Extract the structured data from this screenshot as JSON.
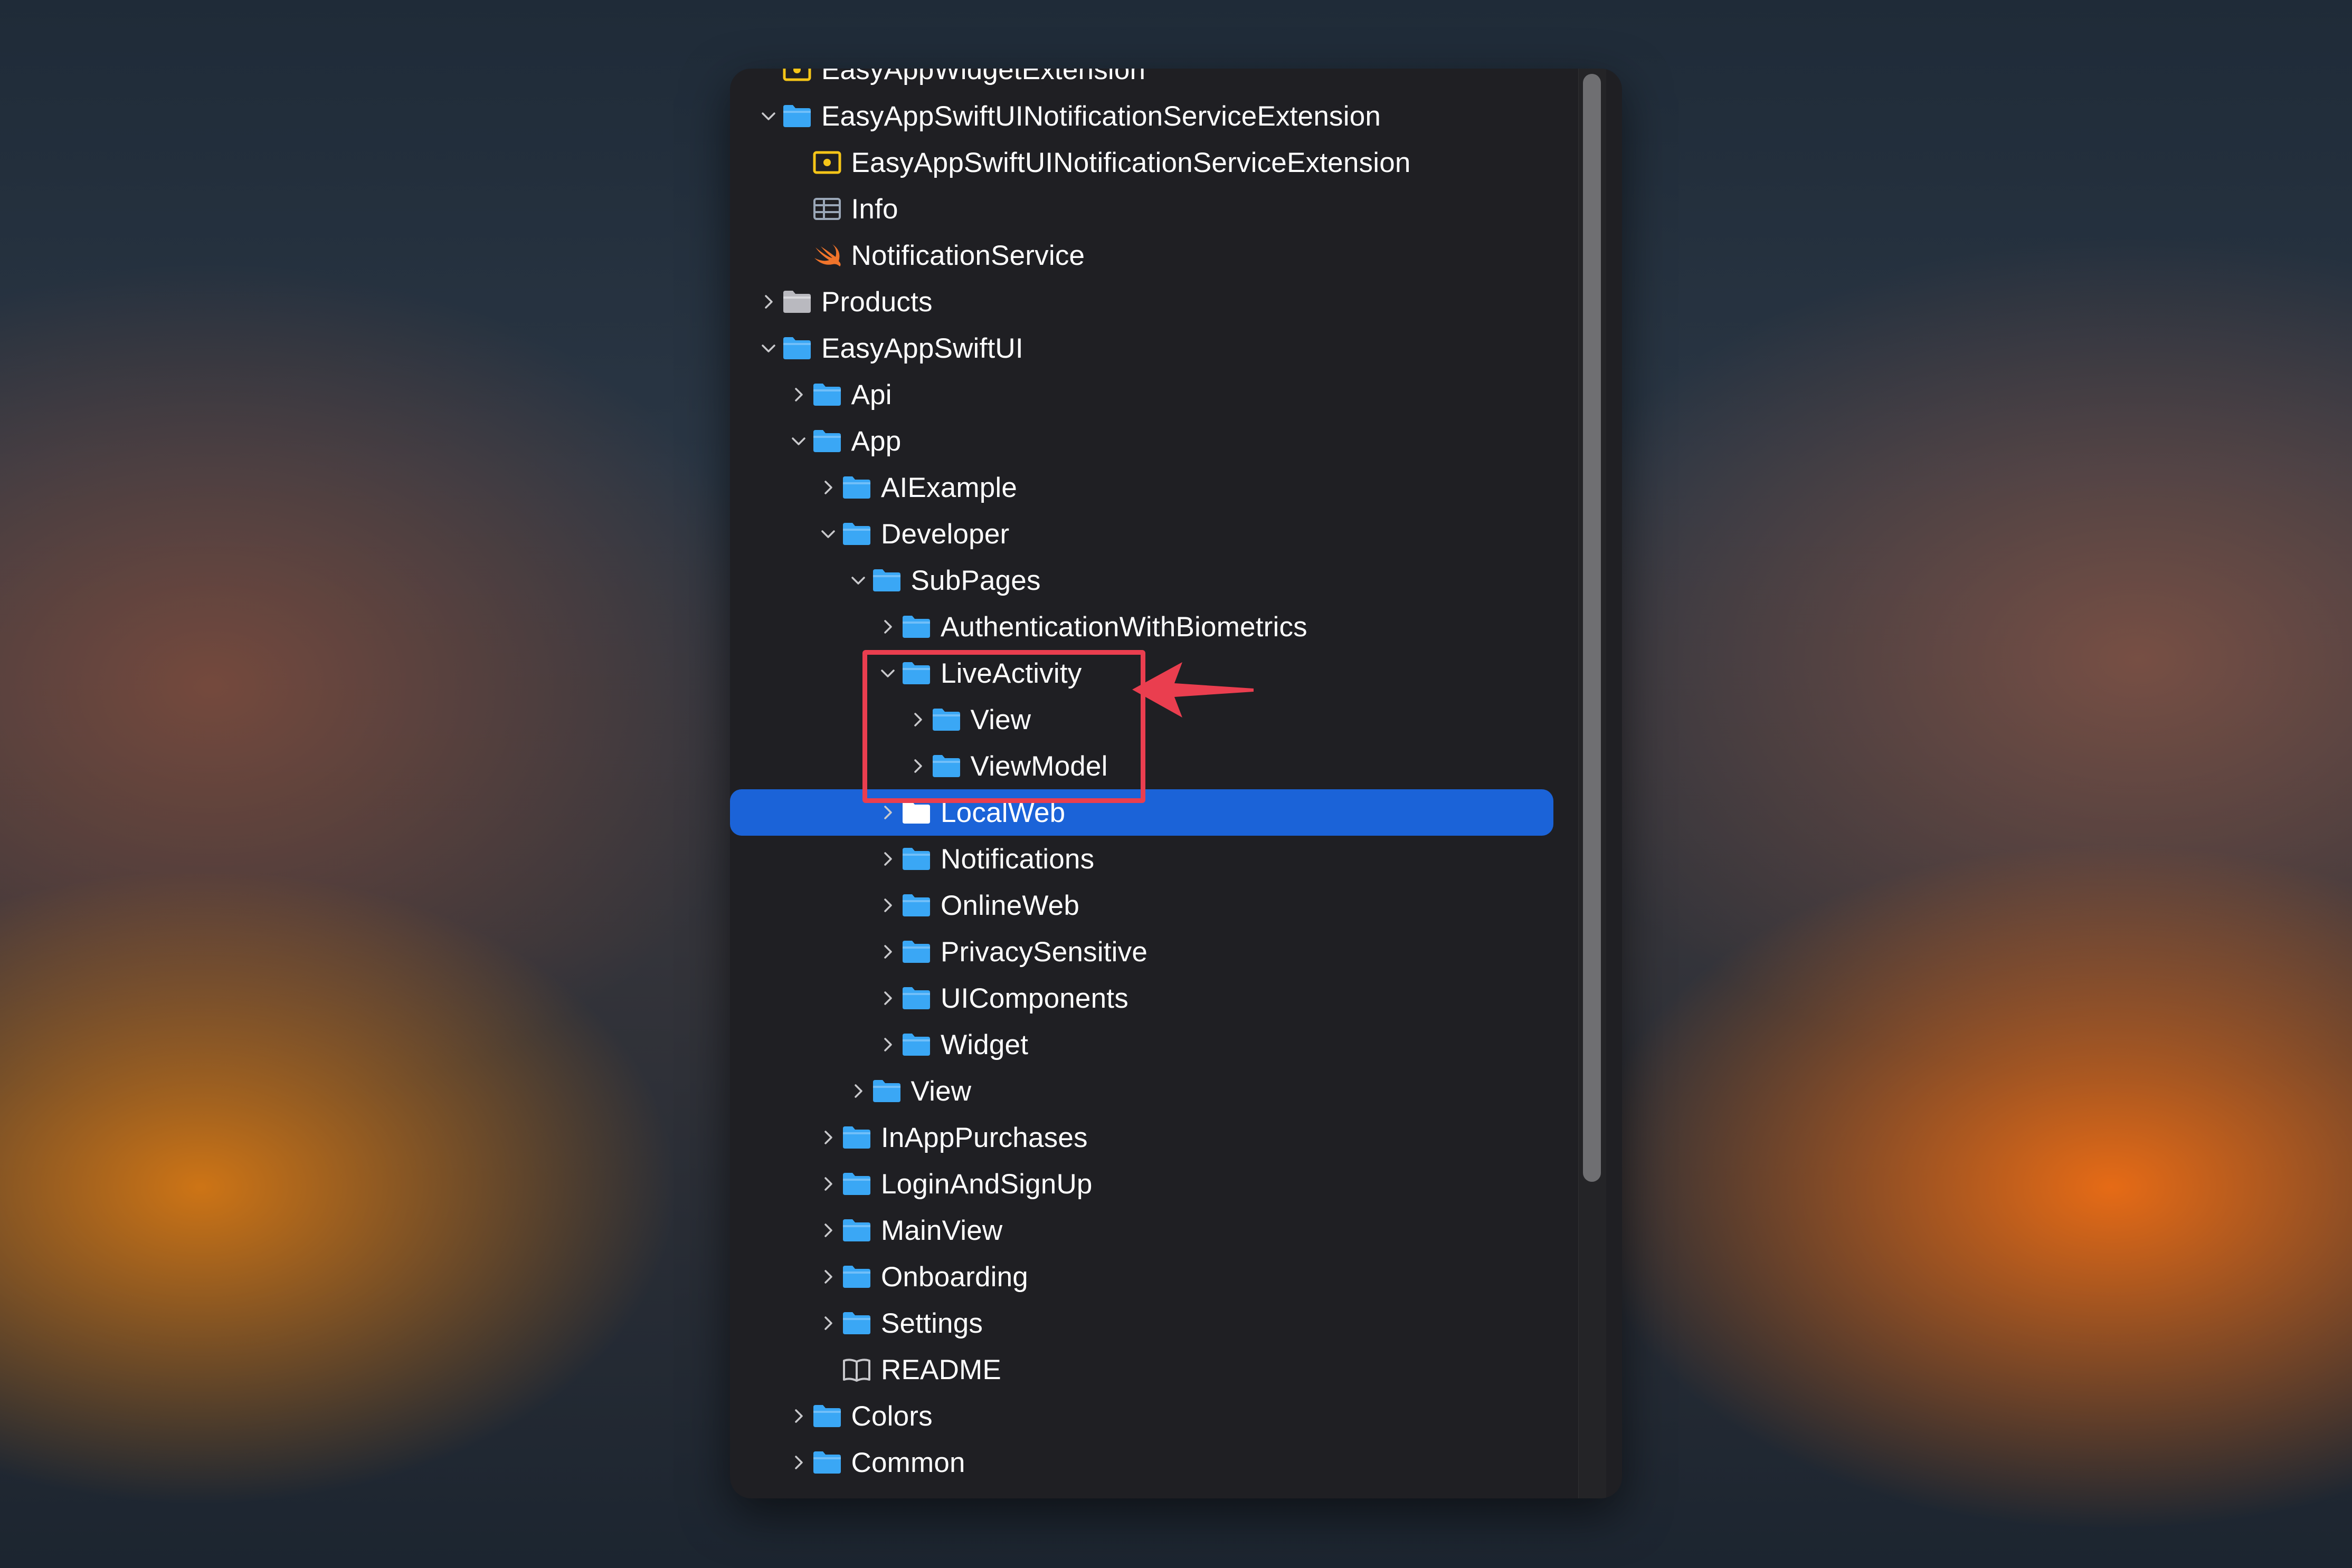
{
  "navigator": {
    "items": [
      {
        "label": "EasyAppWidgetExtension",
        "depth": 1,
        "icon": "target-extension-icon",
        "chevron": "none"
      },
      {
        "label": "EasyAppSwiftUINotificationServiceExtension",
        "depth": 1,
        "icon": "folder-icon",
        "chevron": "down"
      },
      {
        "label": "EasyAppSwiftUINotificationServiceExtension",
        "depth": 2,
        "icon": "target-extension-icon",
        "chevron": "none"
      },
      {
        "label": "Info",
        "depth": 2,
        "icon": "plist-table-icon",
        "chevron": "none"
      },
      {
        "label": "NotificationService",
        "depth": 2,
        "icon": "swift-file-icon",
        "chevron": "none"
      },
      {
        "label": "Products",
        "depth": 1,
        "icon": "products-folder-icon",
        "chevron": "right"
      },
      {
        "label": "EasyAppSwiftUI",
        "depth": 1,
        "icon": "folder-icon",
        "chevron": "down"
      },
      {
        "label": "Api",
        "depth": 2,
        "icon": "folder-icon",
        "chevron": "right"
      },
      {
        "label": "App",
        "depth": 2,
        "icon": "folder-icon",
        "chevron": "down"
      },
      {
        "label": "AIExample",
        "depth": 3,
        "icon": "folder-icon",
        "chevron": "right"
      },
      {
        "label": "Developer",
        "depth": 3,
        "icon": "folder-icon",
        "chevron": "down"
      },
      {
        "label": "SubPages",
        "depth": 4,
        "icon": "folder-icon",
        "chevron": "down"
      },
      {
        "label": "AuthenticationWithBiometrics",
        "depth": 5,
        "icon": "folder-icon",
        "chevron": "right"
      },
      {
        "label": "LiveActivity",
        "depth": 5,
        "icon": "folder-icon",
        "chevron": "down"
      },
      {
        "label": "View",
        "depth": 6,
        "icon": "folder-icon",
        "chevron": "right"
      },
      {
        "label": "ViewModel",
        "depth": 6,
        "icon": "folder-icon",
        "chevron": "right"
      },
      {
        "label": "LocalWeb",
        "depth": 5,
        "icon": "folder-icon",
        "chevron": "right",
        "selected": true
      },
      {
        "label": "Notifications",
        "depth": 5,
        "icon": "folder-icon",
        "chevron": "right"
      },
      {
        "label": "OnlineWeb",
        "depth": 5,
        "icon": "folder-icon",
        "chevron": "right"
      },
      {
        "label": "PrivacySensitive",
        "depth": 5,
        "icon": "folder-icon",
        "chevron": "right"
      },
      {
        "label": "UIComponents",
        "depth": 5,
        "icon": "folder-icon",
        "chevron": "right"
      },
      {
        "label": "Widget",
        "depth": 5,
        "icon": "folder-icon",
        "chevron": "right"
      },
      {
        "label": "View",
        "depth": 4,
        "icon": "folder-icon",
        "chevron": "right"
      },
      {
        "label": "InAppPurchases",
        "depth": 3,
        "icon": "folder-icon",
        "chevron": "right"
      },
      {
        "label": "LoginAndSignUp",
        "depth": 3,
        "icon": "folder-icon",
        "chevron": "right"
      },
      {
        "label": "MainView",
        "depth": 3,
        "icon": "folder-icon",
        "chevron": "right"
      },
      {
        "label": "Onboarding",
        "depth": 3,
        "icon": "folder-icon",
        "chevron": "right"
      },
      {
        "label": "Settings",
        "depth": 3,
        "icon": "folder-icon",
        "chevron": "right"
      },
      {
        "label": "README",
        "depth": 3,
        "icon": "book-icon",
        "chevron": "none"
      },
      {
        "label": "Colors",
        "depth": 2,
        "icon": "folder-icon",
        "chevron": "right"
      },
      {
        "label": "Common",
        "depth": 2,
        "icon": "folder-icon",
        "chevron": "right"
      }
    ]
  },
  "colors": {
    "folder": "#3aa7f5",
    "selection": "#1b63d8",
    "annotation": "#ea3e4f",
    "target": "#f5c518",
    "swift": "#f0742b"
  }
}
